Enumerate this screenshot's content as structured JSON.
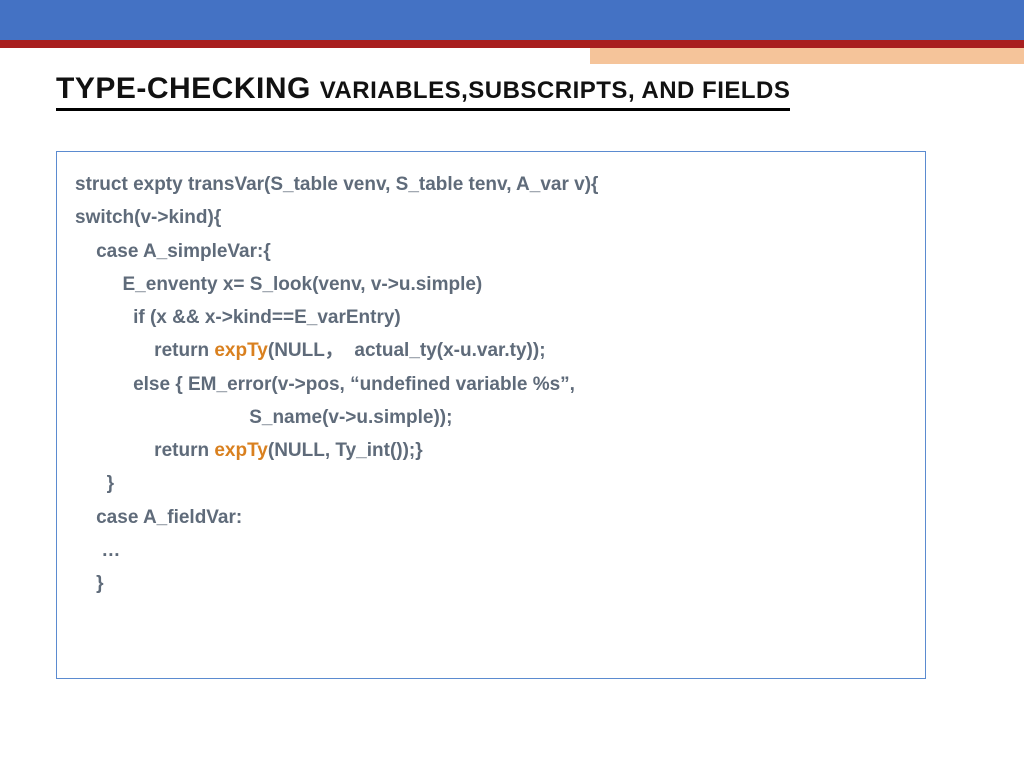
{
  "title_big": "TYPE-CHECKING ",
  "title_small": "VARIABLES,SUBSCRIPTS, AND FIELDS",
  "code": {
    "l1": "struct expty transVar(S_table venv, S_table tenv, A_var v){",
    "l2": "switch(v->kind){",
    "l3": "    case A_simpleVar:{",
    "l4": "         E_enventy x= S_look(venv, v->u.simple)",
    "l5": "           if (x && x->kind==E_varEntry)",
    "l6a": "               return ",
    "l6b": "expTy",
    "l6c": "(NULL，  actual_ty(x-u.var.ty));",
    "l7": "           else { EM_error(v->pos, “undefined variable %s”,",
    "l8": "                                 S_name(v->u.simple));",
    "l9a": "               return ",
    "l9b": "expTy",
    "l9c": "(NULL, Ty_int());}",
    "l10": "      }",
    "l11": "    case A_fieldVar:",
    "l12": "     …",
    "l13": "    }"
  }
}
